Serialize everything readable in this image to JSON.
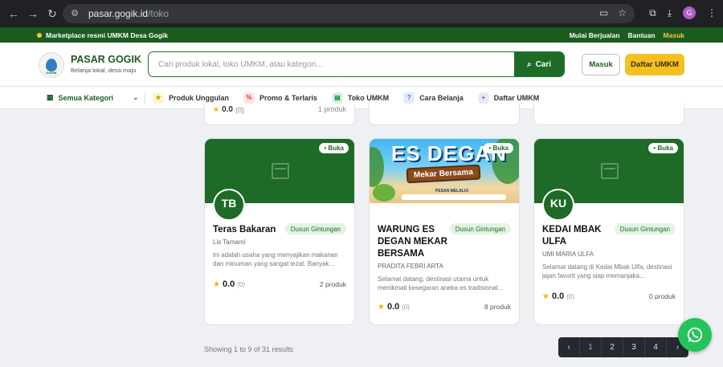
{
  "browser": {
    "url_host": "pasar.gogik.id",
    "url_path": "/toko",
    "profile_initial": "G"
  },
  "topstrip": {
    "notice": "Marketplace resmi UMKM Desa Gogik",
    "links": [
      "Mulai Berjualan",
      "Bantuan",
      "Masuk"
    ]
  },
  "header": {
    "logo_text": "GOGIK",
    "brand_name": "PASAR GOGIK",
    "brand_tagline": "Belanja lokal, desa maju",
    "search_placeholder": "Cari produk lokal, toko UMKM, atau kategori...",
    "search_button": "Cari",
    "login_button": "Masuk",
    "register_button": "Daftar UMKM"
  },
  "catnav": {
    "all_label": "Semua Kategori",
    "items": [
      {
        "label": "Produk Unggulan",
        "icon": "star-icon"
      },
      {
        "label": "Promo & Terlaris",
        "icon": "percent-icon"
      },
      {
        "label": "Toko UMKM",
        "icon": "store-icon"
      },
      {
        "label": "Cara Belanja",
        "icon": "question-icon"
      },
      {
        "label": "Daftar UMKM",
        "icon": "plus-icon"
      }
    ]
  },
  "stub": {
    "score": "0.0",
    "count": "(0)",
    "products": "1 produk"
  },
  "stores": [
    {
      "initials": "TB",
      "status": "Buka",
      "name": "Teras Bakaran",
      "location": "Dusun Gintungan",
      "owner": "Lis Tamami",
      "description": "ini adalah usaha yang menyajikan makanan dan minuman yang sangat lezat. Banyak...",
      "rating": "0.0",
      "reviews": "(0)",
      "products": "2 produk"
    },
    {
      "banner_title": "ES DEGAN",
      "banner_subtitle": "Mekar Bersama",
      "banner_note": "PESAN MELALUI",
      "status": "Buka",
      "name": "WARUNG ES DEGAN MEKAR BERSAMA",
      "location": "Dusun Gintungan",
      "owner": "PRADITA FEBRI ARTA",
      "description": "Selamat datang, destinasi utama untuk menikmati kesegaran aneka es tradisional...",
      "rating": "0.0",
      "reviews": "(0)",
      "products": "8 produk"
    },
    {
      "initials": "KU",
      "status": "Buka",
      "name": "KEDAI MBAK ULFA",
      "location": "Dusun Gintungan",
      "owner": "UMI MARIA ULFA",
      "description": "Selamat datang di Kedai Mbak Ulfa, destinasi jajan favorit yang siap memanjaka...",
      "rating": "0.0",
      "reviews": "(0)",
      "products": "0 produk"
    }
  ],
  "pagination": {
    "summary": "Showing 1 to 9 of 31 results",
    "pages": [
      "1",
      "2",
      "3",
      "4"
    ],
    "prev": "‹",
    "next": "›"
  },
  "colors": {
    "brand_green": "#1d5c1f",
    "accent_yellow": "#f5c023",
    "whatsapp": "#24c45a"
  }
}
